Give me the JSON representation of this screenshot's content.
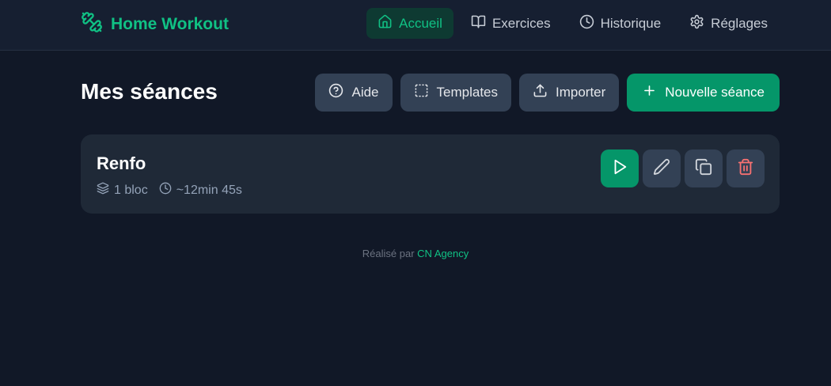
{
  "app": {
    "title": "Home Workout",
    "brand_color": "#10c184",
    "logo_icon": "dumbbell-icon"
  },
  "nav": {
    "items": [
      {
        "label": "Accueil",
        "icon": "home-icon",
        "active": true
      },
      {
        "label": "Exercices",
        "icon": "book-icon",
        "active": false
      },
      {
        "label": "Historique",
        "icon": "clock-icon",
        "active": false
      },
      {
        "label": "Réglages",
        "icon": "gear-icon",
        "active": false
      }
    ]
  },
  "page": {
    "title": "Mes séances"
  },
  "actions": {
    "help_label": "Aide",
    "templates_label": "Templates",
    "import_label": "Importer",
    "new_session_label": "Nouvelle séance"
  },
  "sessions": [
    {
      "name": "Renfo",
      "blocks": "1 bloc",
      "duration": "~12min 45s",
      "actions": [
        "play-icon",
        "pencil-icon",
        "copy-icon",
        "trash-icon"
      ]
    }
  ],
  "footer": {
    "prefix": "Réalisé par",
    "link": "CN Agency"
  },
  "colors": {
    "background": "#111827",
    "card": "#1f2937",
    "primary": "#059669",
    "danger": "#f87171"
  }
}
